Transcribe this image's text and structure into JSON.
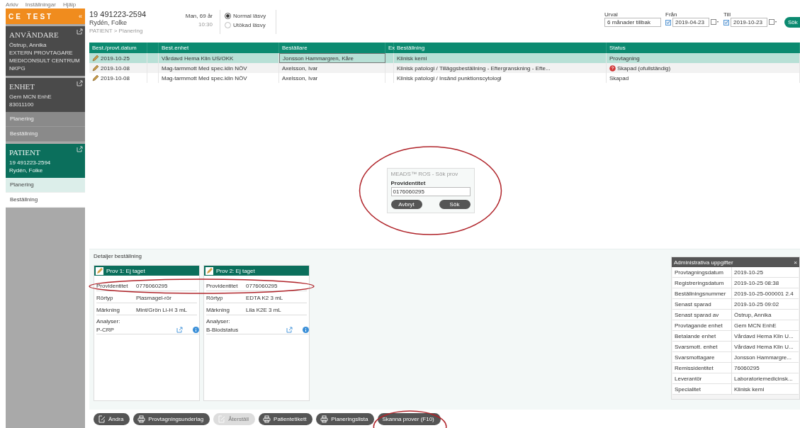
{
  "menu": [
    "Arkiv",
    "Inställningar",
    "Hjälp"
  ],
  "sidebar": {
    "logo": "CE TEST",
    "collapse": "«",
    "sections": [
      {
        "title": "ANVÄNDARE",
        "kind": "dark",
        "lines": [
          "Östrup, Annika",
          "EXTERN PROVTAGARE",
          "MEDICONSULT CENTRUM",
          "NKPG"
        ]
      },
      {
        "title": "ENHET",
        "kind": "dark",
        "lines": [
          "Gem MCN EnhE",
          "83011100"
        ],
        "items": [
          {
            "label": "Planering",
            "selected": false
          },
          {
            "label": "Beställning",
            "selected": false
          }
        ]
      },
      {
        "title": "PATIENT",
        "kind": "teal",
        "lines": [
          "19 491223-2594",
          "Rydén, Folke"
        ],
        "items": [
          {
            "label": "Planering",
            "selected": true
          },
          {
            "label": "Beställning",
            "selected": false
          }
        ]
      }
    ]
  },
  "header": {
    "patient_id": "19 491223-2594",
    "patient_name": "Rydén, Folke",
    "breadcrumb": "PATIENT > Planering",
    "sex_age": "Man, 69 år",
    "time": "10:30"
  },
  "view_options": [
    {
      "label": "Normal läsvy",
      "selected": true
    },
    {
      "label": "Utökad läsvy",
      "selected": false
    }
  ],
  "filters": [
    {
      "label": "Urval",
      "value": "6 månader tillbak",
      "kind": "select"
    },
    {
      "label": "Från",
      "value": "2019-04-23",
      "kind": "date",
      "checked": true
    },
    {
      "label": "Till",
      "value": "2019-10-23",
      "kind": "date",
      "checked": true
    }
  ],
  "search_button": "Sök",
  "table": {
    "columns": [
      "Best./provt.datum",
      "",
      "Best.enhet",
      "Beställare",
      "Ex",
      "Beställning",
      "Status"
    ],
    "rows": [
      {
        "selected": true,
        "warning": false,
        "cells": [
          "2019-10-25",
          "",
          "Vårdavd Hema Klin US/OKK",
          "Jonsson Hammargren, Kåre",
          "",
          "Klinisk kemi",
          "Provtagning"
        ]
      },
      {
        "selected": false,
        "warning": true,
        "cells": [
          "2019-10-08",
          "",
          "Mag-tarmmott Med spec.klin NÖV",
          "Axelsson, Ivar",
          "",
          "Klinisk patologi / Tilläggsbeställning - Eftergranskning - Efte...",
          "Skapad (ofullständig)"
        ]
      },
      {
        "selected": false,
        "warning": false,
        "cells": [
          "2019-10-08",
          "",
          "Mag-tarmmott Med spec.klin NÖV",
          "Axelsson, Ivar",
          "",
          "Klinisk patologi / Insänd punktionscytologi",
          "Skapad"
        ]
      }
    ]
  },
  "dialog": {
    "title": "MEADS™ ROS - Sök prov",
    "field_label": "Providentitet",
    "value": "0176060295",
    "buttons": [
      "Avbryt",
      "Sök"
    ]
  },
  "details": {
    "title": "Detaljer beställning",
    "samples": [
      {
        "title": "Prov 1: Ej taget",
        "rows": [
          {
            "label": "Providentitet",
            "value": "0776060295"
          },
          {
            "label": "Rörtyp",
            "value": "Plasmagel-rör"
          },
          {
            "label": "Märkning",
            "value": "Mint/Grön Li-H 3 mL"
          }
        ],
        "analyses_label": "Analyser:",
        "analyses": [
          "P-CRP"
        ]
      },
      {
        "title": "Prov 2: Ej taget",
        "rows": [
          {
            "label": "Providentitet",
            "value": "0776060295"
          },
          {
            "label": "Rörtyp",
            "value": "EDTA K2 3 mL"
          },
          {
            "label": "Märkning",
            "value": "Lila K2E 3 mL"
          }
        ],
        "analyses_label": "Analyser:",
        "analyses": [
          "B-Blodstatus"
        ]
      }
    ]
  },
  "admin": {
    "title": "Administrativa uppgifter",
    "close": "×",
    "rows": [
      {
        "label": "Provtagningsdatum",
        "value": "2019-10-25"
      },
      {
        "label": "Registreringsdatum",
        "value": "2019-10-25 08:38"
      },
      {
        "label": "Beställningsnummer",
        "value": "2019-10-25-000001 2.4"
      },
      {
        "label": "Senast sparad",
        "value": "2019-10-25 09:02"
      },
      {
        "label": "Senast sparad av",
        "value": "Östrup, Annika"
      },
      {
        "label": "Provtagande enhet",
        "value": "Gem MCN EnhE"
      },
      {
        "label": "Betalande enhet",
        "value": "Vårdavd Hema Klin U..."
      },
      {
        "label": "Svarsmott. enhet",
        "value": "Vårdavd Hema Klin U..."
      },
      {
        "label": "Svarsmottagare",
        "value": "Jonsson Hammargre..."
      },
      {
        "label": "Remissidentitet",
        "value": "76060295"
      },
      {
        "label": "Leverantör",
        "value": "Laboratoriemedicinsk..."
      },
      {
        "label": "Specialitet",
        "value": "Klinisk kemi"
      }
    ]
  },
  "actions": [
    {
      "label": "Ändra",
      "disabled": false
    },
    {
      "label": "Provtagningsunderlag",
      "disabled": false
    },
    {
      "label": "Återställ",
      "disabled": true
    },
    {
      "label": "Patientetikett",
      "disabled": false
    },
    {
      "label": "Planeringslista",
      "disabled": false
    },
    {
      "label": "Skanna prover (F10)",
      "disabled": false
    }
  ]
}
